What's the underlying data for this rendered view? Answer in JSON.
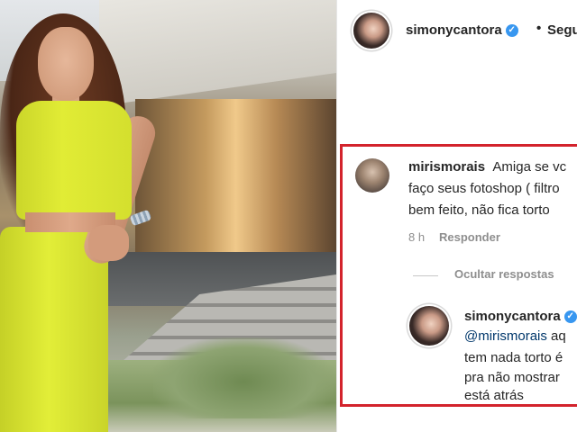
{
  "post": {
    "username": "simonycantora",
    "follow_separator": "•",
    "follow_label": "Segu"
  },
  "comment": {
    "username": "mirismorais",
    "line1": "Amiga se vc",
    "line2": "faço seus fotoshop ( filtro",
    "line3": "bem feito, não fica torto",
    "time": "8 h",
    "reply_label": "Responder",
    "hide_replies_label": "Ocultar respostas"
  },
  "reply": {
    "username": "simonycantora",
    "mention": "@mirismorais",
    "line1_rest": " aq",
    "line2": "tem nada torto é",
    "line3": "pra não mostrar",
    "line4": "está atrás"
  },
  "colors": {
    "highlight_border": "#d3232c",
    "verified_badge": "#3897f0",
    "mention": "#00376b",
    "meta_text": "#8e8e8e"
  },
  "icons": {
    "verified": "verified-badge-icon"
  }
}
